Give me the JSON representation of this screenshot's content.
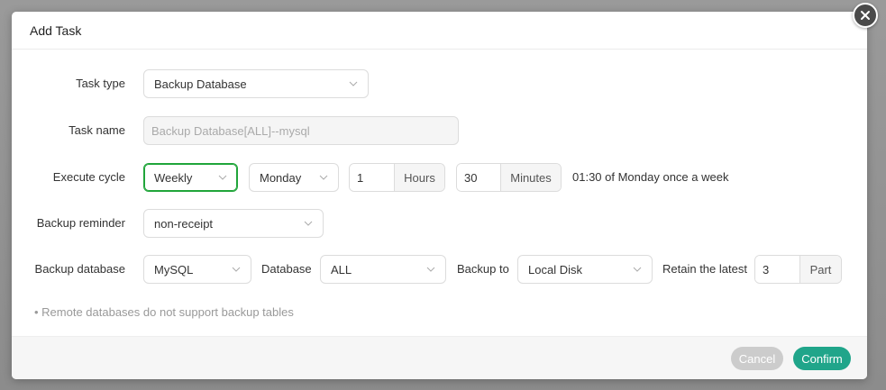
{
  "dialog": {
    "title": "Add Task"
  },
  "form": {
    "task_type": {
      "label": "Task type",
      "value": "Backup Database"
    },
    "task_name": {
      "label": "Task name",
      "value": "Backup Database[ALL]--mysql"
    },
    "execute_cycle": {
      "label": "Execute cycle",
      "cycle": "Weekly",
      "day": "Monday",
      "hours_value": "1",
      "hours_unit": "Hours",
      "minutes_value": "30",
      "minutes_unit": "Minutes",
      "summary": "01:30 of Monday once a week"
    },
    "backup_reminder": {
      "label": "Backup reminder",
      "value": "non-receipt"
    },
    "backup_database": {
      "label": "Backup database",
      "db_type": "MySQL",
      "database_label": "Database",
      "database_value": "ALL",
      "backup_to_label": "Backup to",
      "backup_to_value": "Local Disk",
      "retain_label": "Retain the latest",
      "retain_value": "3",
      "retain_unit": "Part"
    },
    "note": "• Remote databases do not support backup tables"
  },
  "footer": {
    "cancel_label": "Cancel",
    "confirm_label": "Confirm"
  },
  "colors": {
    "accent": "#20a58a",
    "focus_border": "#20a53a",
    "cancel_bg": "#cccccc"
  },
  "icons": {
    "close": "close-icon",
    "dropdown": "chevron-down-icon"
  }
}
